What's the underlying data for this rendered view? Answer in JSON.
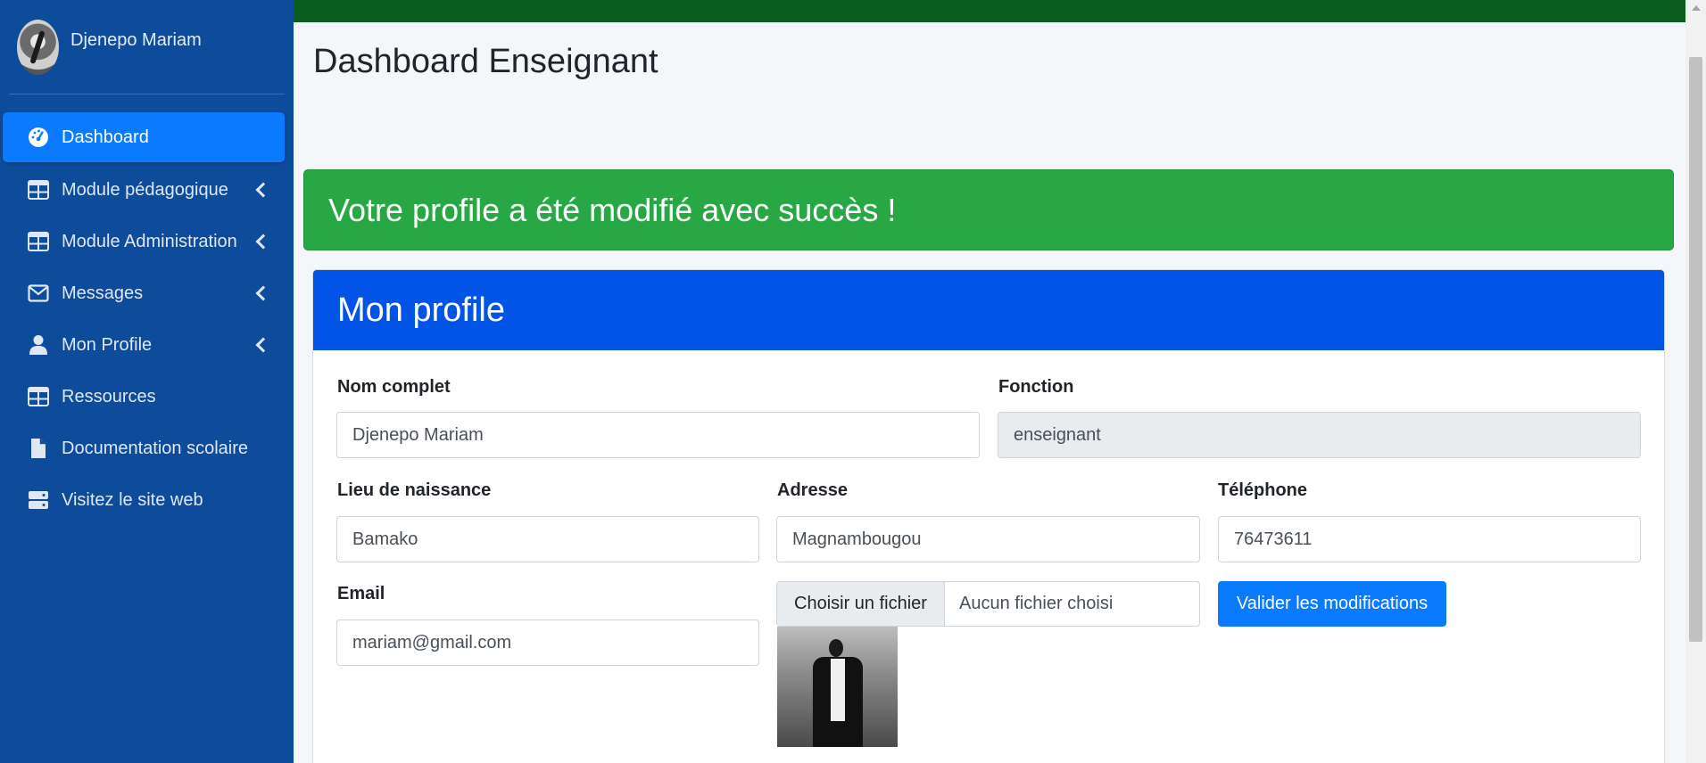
{
  "user": {
    "name": "Djenepo Mariam"
  },
  "nav": {
    "items": [
      {
        "label": "Dashboard",
        "icon": "dashboard-icon",
        "active": true,
        "has_chevron": false
      },
      {
        "label": "Module pédagogique",
        "icon": "table-icon",
        "active": false,
        "has_chevron": true
      },
      {
        "label": "Module Administration",
        "icon": "table-icon",
        "active": false,
        "has_chevron": true
      },
      {
        "label": "Messages",
        "icon": "envelope-icon",
        "active": false,
        "has_chevron": true
      },
      {
        "label": "Mon Profile",
        "icon": "user-icon",
        "active": false,
        "has_chevron": true
      },
      {
        "label": "Ressources",
        "icon": "table-icon",
        "active": false,
        "has_chevron": false
      },
      {
        "label": "Documentation scolaire",
        "icon": "file-icon",
        "active": false,
        "has_chevron": false
      },
      {
        "label": "Visitez le site web",
        "icon": "server-icon",
        "active": false,
        "has_chevron": false
      }
    ]
  },
  "page": {
    "title": "Dashboard Enseignant"
  },
  "alert": {
    "text": "Votre profile a été modifié avec succès !"
  },
  "profile": {
    "header": "Mon profile",
    "fields": {
      "nom": {
        "label": "Nom complet",
        "value": "Djenepo Mariam"
      },
      "fonction": {
        "label": "Fonction",
        "value": "enseignant"
      },
      "lieu": {
        "label": "Lieu de naissance",
        "value": "Bamako"
      },
      "adresse": {
        "label": "Adresse",
        "value": "Magnambougou"
      },
      "telephone": {
        "label": "Téléphone",
        "value": "76473611"
      },
      "email": {
        "label": "Email",
        "value": "mariam@gmail.com"
      }
    },
    "file": {
      "button": "Choisir un fichier",
      "status": "Aucun fichier choisi"
    },
    "submit": "Valider les modifications"
  },
  "colors": {
    "sidebar": "#0d4c9a",
    "active_nav": "#0a7bff",
    "topbar": "#0b5e1e",
    "alert": "#28a745",
    "card_header": "#0254e6"
  }
}
